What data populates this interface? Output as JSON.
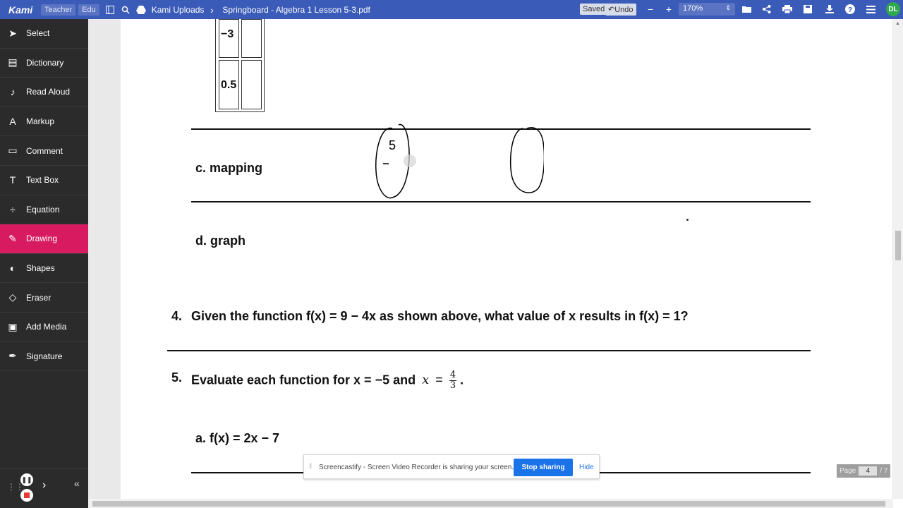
{
  "topbar": {
    "logo": "Kami",
    "chips": [
      "Teacher",
      "Edu"
    ],
    "folder": "Kami Uploads",
    "filename": "Springboard - Algebra 1 Lesson 5-3.pdf",
    "saved": "Saved",
    "undo": "Undo",
    "zoom": "170%",
    "avatar": "DL"
  },
  "sidebar": {
    "tools": [
      {
        "label": "Select",
        "icon": "cursor-icon"
      },
      {
        "label": "Dictionary",
        "icon": "book-icon"
      },
      {
        "label": "Read Aloud",
        "icon": "speaker-icon"
      },
      {
        "label": "Markup",
        "icon": "markup-icon"
      },
      {
        "label": "Comment",
        "icon": "comment-icon"
      },
      {
        "label": "Text Box",
        "icon": "textbox-icon"
      },
      {
        "label": "Equation",
        "icon": "equation-icon"
      },
      {
        "label": "Drawing",
        "icon": "pen-icon",
        "active": true
      },
      {
        "label": "Shapes",
        "icon": "shapes-icon"
      },
      {
        "label": "Eraser",
        "icon": "eraser-icon"
      },
      {
        "label": "Add Media",
        "icon": "media-icon"
      },
      {
        "label": "Signature",
        "icon": "signature-icon"
      }
    ]
  },
  "palette": {
    "stroke_size": "1",
    "colors": [
      "#ffff00",
      "#000000",
      "#00ff00"
    ]
  },
  "document": {
    "table_values": [
      "−3",
      "0.5"
    ],
    "item_c": "c.  mapping",
    "item_d": "d.  graph",
    "q4_num": "4.",
    "q4_text": "Given the function f(x) = 9 − 4x as shown above, what value of x results in f(x) = 1?",
    "q5_num": "5.",
    "q5_text": "Evaluate each function for x = −5 and",
    "q5_var": "x",
    "q5_eq": "=",
    "q5_frac_num": "4",
    "q5_frac_den": "3",
    "q5_end": ".",
    "q5a": "a.  f(x) = 2x − 7",
    "handwriting": "5"
  },
  "notification": {
    "text": "Screencastify - Screen Video Recorder is sharing your screen.",
    "stop": "Stop sharing",
    "hide": "Hide"
  },
  "page_indicator": {
    "label": "Page",
    "current": "4",
    "total": "/ 7"
  }
}
